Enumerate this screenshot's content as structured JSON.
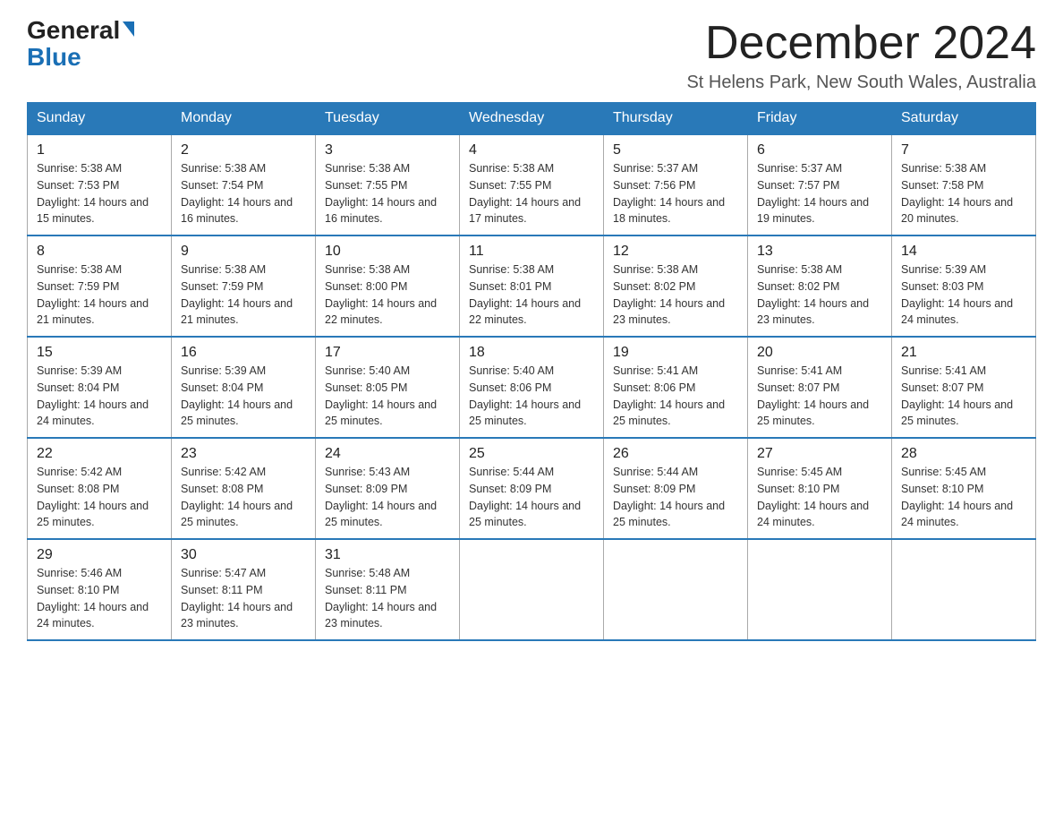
{
  "logo": {
    "general": "General",
    "blue": "Blue",
    "triangle": "▶"
  },
  "header": {
    "month_year": "December 2024",
    "location": "St Helens Park, New South Wales, Australia"
  },
  "weekdays": [
    "Sunday",
    "Monday",
    "Tuesday",
    "Wednesday",
    "Thursday",
    "Friday",
    "Saturday"
  ],
  "weeks": [
    [
      {
        "day": "1",
        "sunrise": "5:38 AM",
        "sunset": "7:53 PM",
        "daylight": "14 hours and 15 minutes."
      },
      {
        "day": "2",
        "sunrise": "5:38 AM",
        "sunset": "7:54 PM",
        "daylight": "14 hours and 16 minutes."
      },
      {
        "day": "3",
        "sunrise": "5:38 AM",
        "sunset": "7:55 PM",
        "daylight": "14 hours and 16 minutes."
      },
      {
        "day": "4",
        "sunrise": "5:38 AM",
        "sunset": "7:55 PM",
        "daylight": "14 hours and 17 minutes."
      },
      {
        "day": "5",
        "sunrise": "5:37 AM",
        "sunset": "7:56 PM",
        "daylight": "14 hours and 18 minutes."
      },
      {
        "day": "6",
        "sunrise": "5:37 AM",
        "sunset": "7:57 PM",
        "daylight": "14 hours and 19 minutes."
      },
      {
        "day": "7",
        "sunrise": "5:38 AM",
        "sunset": "7:58 PM",
        "daylight": "14 hours and 20 minutes."
      }
    ],
    [
      {
        "day": "8",
        "sunrise": "5:38 AM",
        "sunset": "7:59 PM",
        "daylight": "14 hours and 21 minutes."
      },
      {
        "day": "9",
        "sunrise": "5:38 AM",
        "sunset": "7:59 PM",
        "daylight": "14 hours and 21 minutes."
      },
      {
        "day": "10",
        "sunrise": "5:38 AM",
        "sunset": "8:00 PM",
        "daylight": "14 hours and 22 minutes."
      },
      {
        "day": "11",
        "sunrise": "5:38 AM",
        "sunset": "8:01 PM",
        "daylight": "14 hours and 22 minutes."
      },
      {
        "day": "12",
        "sunrise": "5:38 AM",
        "sunset": "8:02 PM",
        "daylight": "14 hours and 23 minutes."
      },
      {
        "day": "13",
        "sunrise": "5:38 AM",
        "sunset": "8:02 PM",
        "daylight": "14 hours and 23 minutes."
      },
      {
        "day": "14",
        "sunrise": "5:39 AM",
        "sunset": "8:03 PM",
        "daylight": "14 hours and 24 minutes."
      }
    ],
    [
      {
        "day": "15",
        "sunrise": "5:39 AM",
        "sunset": "8:04 PM",
        "daylight": "14 hours and 24 minutes."
      },
      {
        "day": "16",
        "sunrise": "5:39 AM",
        "sunset": "8:04 PM",
        "daylight": "14 hours and 25 minutes."
      },
      {
        "day": "17",
        "sunrise": "5:40 AM",
        "sunset": "8:05 PM",
        "daylight": "14 hours and 25 minutes."
      },
      {
        "day": "18",
        "sunrise": "5:40 AM",
        "sunset": "8:06 PM",
        "daylight": "14 hours and 25 minutes."
      },
      {
        "day": "19",
        "sunrise": "5:41 AM",
        "sunset": "8:06 PM",
        "daylight": "14 hours and 25 minutes."
      },
      {
        "day": "20",
        "sunrise": "5:41 AM",
        "sunset": "8:07 PM",
        "daylight": "14 hours and 25 minutes."
      },
      {
        "day": "21",
        "sunrise": "5:41 AM",
        "sunset": "8:07 PM",
        "daylight": "14 hours and 25 minutes."
      }
    ],
    [
      {
        "day": "22",
        "sunrise": "5:42 AM",
        "sunset": "8:08 PM",
        "daylight": "14 hours and 25 minutes."
      },
      {
        "day": "23",
        "sunrise": "5:42 AM",
        "sunset": "8:08 PM",
        "daylight": "14 hours and 25 minutes."
      },
      {
        "day": "24",
        "sunrise": "5:43 AM",
        "sunset": "8:09 PM",
        "daylight": "14 hours and 25 minutes."
      },
      {
        "day": "25",
        "sunrise": "5:44 AM",
        "sunset": "8:09 PM",
        "daylight": "14 hours and 25 minutes."
      },
      {
        "day": "26",
        "sunrise": "5:44 AM",
        "sunset": "8:09 PM",
        "daylight": "14 hours and 25 minutes."
      },
      {
        "day": "27",
        "sunrise": "5:45 AM",
        "sunset": "8:10 PM",
        "daylight": "14 hours and 24 minutes."
      },
      {
        "day": "28",
        "sunrise": "5:45 AM",
        "sunset": "8:10 PM",
        "daylight": "14 hours and 24 minutes."
      }
    ],
    [
      {
        "day": "29",
        "sunrise": "5:46 AM",
        "sunset": "8:10 PM",
        "daylight": "14 hours and 24 minutes."
      },
      {
        "day": "30",
        "sunrise": "5:47 AM",
        "sunset": "8:11 PM",
        "daylight": "14 hours and 23 minutes."
      },
      {
        "day": "31",
        "sunrise": "5:48 AM",
        "sunset": "8:11 PM",
        "daylight": "14 hours and 23 minutes."
      },
      null,
      null,
      null,
      null
    ]
  ]
}
